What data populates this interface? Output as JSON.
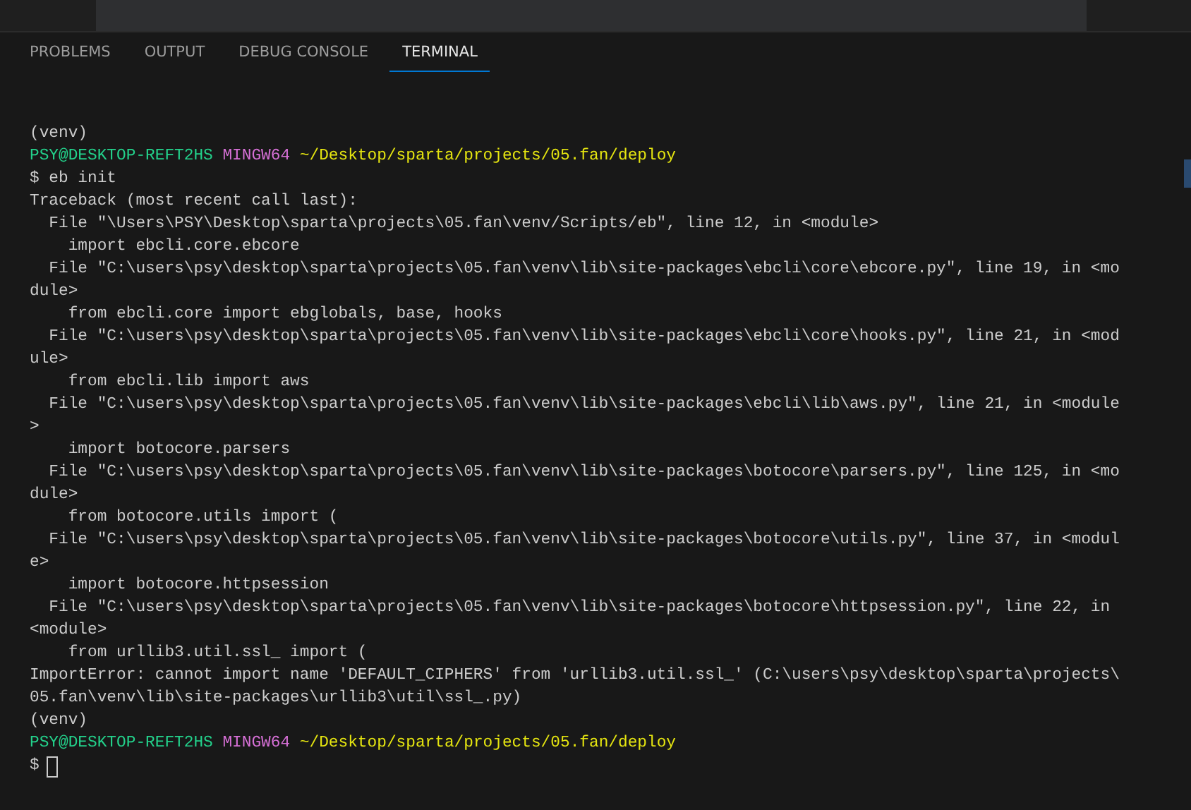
{
  "tabs": [
    {
      "label": "PROBLEMS",
      "selected": false
    },
    {
      "label": "OUTPUT",
      "selected": false
    },
    {
      "label": "DEBUG CONSOLE",
      "selected": false
    },
    {
      "label": "TERMINAL",
      "selected": true
    }
  ],
  "terminal": {
    "lines": [
      {
        "kind": "text",
        "text": "(venv)"
      },
      {
        "kind": "prompt",
        "user": "PSY@DESKTOP-REFT2HS",
        "shell": "MINGW64",
        "path": "~/Desktop/sparta/projects/05.fan/deploy"
      },
      {
        "kind": "text",
        "text": "$ eb init"
      },
      {
        "kind": "text",
        "text": "Traceback (most recent call last):"
      },
      {
        "kind": "text",
        "text": "  File \"\\Users\\PSY\\Desktop\\sparta\\projects\\05.fan\\venv/Scripts/eb\", line 12, in <module>"
      },
      {
        "kind": "text",
        "text": "    import ebcli.core.ebcore"
      },
      {
        "kind": "text",
        "text": "  File \"C:\\users\\psy\\desktop\\sparta\\projects\\05.fan\\venv\\lib\\site-packages\\ebcli\\core\\ebcore.py\", line 19, in <mo"
      },
      {
        "kind": "text",
        "text": "dule>"
      },
      {
        "kind": "text",
        "text": "    from ebcli.core import ebglobals, base, hooks"
      },
      {
        "kind": "text",
        "text": "  File \"C:\\users\\psy\\desktop\\sparta\\projects\\05.fan\\venv\\lib\\site-packages\\ebcli\\core\\hooks.py\", line 21, in <mod"
      },
      {
        "kind": "text",
        "text": "ule>"
      },
      {
        "kind": "text",
        "text": "    from ebcli.lib import aws"
      },
      {
        "kind": "text",
        "text": "  File \"C:\\users\\psy\\desktop\\sparta\\projects\\05.fan\\venv\\lib\\site-packages\\ebcli\\lib\\aws.py\", line 21, in <module"
      },
      {
        "kind": "text",
        "text": ">"
      },
      {
        "kind": "text",
        "text": "    import botocore.parsers"
      },
      {
        "kind": "text",
        "text": "  File \"C:\\users\\psy\\desktop\\sparta\\projects\\05.fan\\venv\\lib\\site-packages\\botocore\\parsers.py\", line 125, in <mo"
      },
      {
        "kind": "text",
        "text": "dule>"
      },
      {
        "kind": "text",
        "text": "    from botocore.utils import ("
      },
      {
        "kind": "text",
        "text": "  File \"C:\\users\\psy\\desktop\\sparta\\projects\\05.fan\\venv\\lib\\site-packages\\botocore\\utils.py\", line 37, in <modul"
      },
      {
        "kind": "text",
        "text": "e>"
      },
      {
        "kind": "text",
        "text": "    import botocore.httpsession"
      },
      {
        "kind": "text",
        "text": "  File \"C:\\users\\psy\\desktop\\sparta\\projects\\05.fan\\venv\\lib\\site-packages\\botocore\\httpsession.py\", line 22, in"
      },
      {
        "kind": "text",
        "text": "<module>"
      },
      {
        "kind": "text",
        "text": "    from urllib3.util.ssl_ import ("
      },
      {
        "kind": "text",
        "text": "ImportError: cannot import name 'DEFAULT_CIPHERS' from 'urllib3.util.ssl_' (C:\\users\\psy\\desktop\\sparta\\projects\\"
      },
      {
        "kind": "text",
        "text": "05.fan\\venv\\lib\\site-packages\\urllib3\\util\\ssl_.py)"
      },
      {
        "kind": "text",
        "text": "(venv)"
      },
      {
        "kind": "prompt",
        "user": "PSY@DESKTOP-REFT2HS",
        "shell": "MINGW64",
        "path": "~/Desktop/sparta/projects/05.fan/deploy"
      },
      {
        "kind": "input",
        "text": "$"
      }
    ]
  }
}
